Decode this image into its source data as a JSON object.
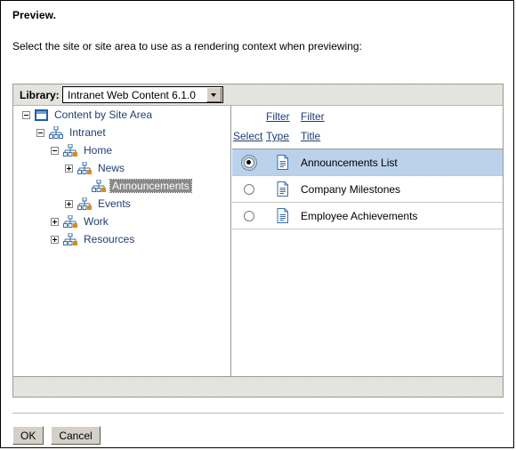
{
  "dialog": {
    "title": "Preview.",
    "instruction": "Select the site or site area to use as a rendering context when previewing:"
  },
  "toolbar": {
    "library_label": "Library:",
    "library_value": "Intranet Web Content 6.1.0",
    "dropdown_icon": "chevron-down-icon"
  },
  "tree": {
    "nodes": [
      {
        "label": "Content by Site Area",
        "depth": 0,
        "twisty": "minus",
        "icon": "library-window-icon",
        "selected": false
      },
      {
        "label": "Intranet",
        "depth": 1,
        "twisty": "minus",
        "icon": "site-hierarchy-icon",
        "selected": false
      },
      {
        "label": "Home",
        "depth": 2,
        "twisty": "minus",
        "icon": "site-area-icon",
        "selected": false
      },
      {
        "label": "News",
        "depth": 3,
        "twisty": "plus",
        "icon": "site-area-icon",
        "selected": false
      },
      {
        "label": "Announcements",
        "depth": 4,
        "twisty": "none",
        "icon": "site-area-icon",
        "selected": true
      },
      {
        "label": "Events",
        "depth": 3,
        "twisty": "plus",
        "icon": "site-area-icon",
        "selected": false
      },
      {
        "label": "Work",
        "depth": 2,
        "twisty": "plus",
        "icon": "site-area-icon",
        "selected": false
      },
      {
        "label": "Resources",
        "depth": 2,
        "twisty": "plus",
        "icon": "site-area-icon",
        "selected": false
      }
    ]
  },
  "list": {
    "filter_type_label": "Filter",
    "filter_title_label": "Filter",
    "col_select": "Select",
    "col_type": "Type",
    "col_title": "Title",
    "rows": [
      {
        "title": "Announcements List",
        "type_icon": "document-icon",
        "selected": true,
        "focused": true
      },
      {
        "title": "Company Milestones",
        "type_icon": "document-icon",
        "selected": false,
        "focused": false
      },
      {
        "title": "Employee Achievements",
        "type_icon": "document-icon",
        "selected": false,
        "focused": false
      }
    ]
  },
  "buttons": {
    "ok": "OK",
    "cancel": "Cancel"
  },
  "colors": {
    "selected_row": "#cdddf0",
    "tree_link": "#1f3f6f",
    "toolbar_grey": "#f1f1ee",
    "icon_blue": "#3a6ea5",
    "icon_orange": "#e08a12"
  }
}
